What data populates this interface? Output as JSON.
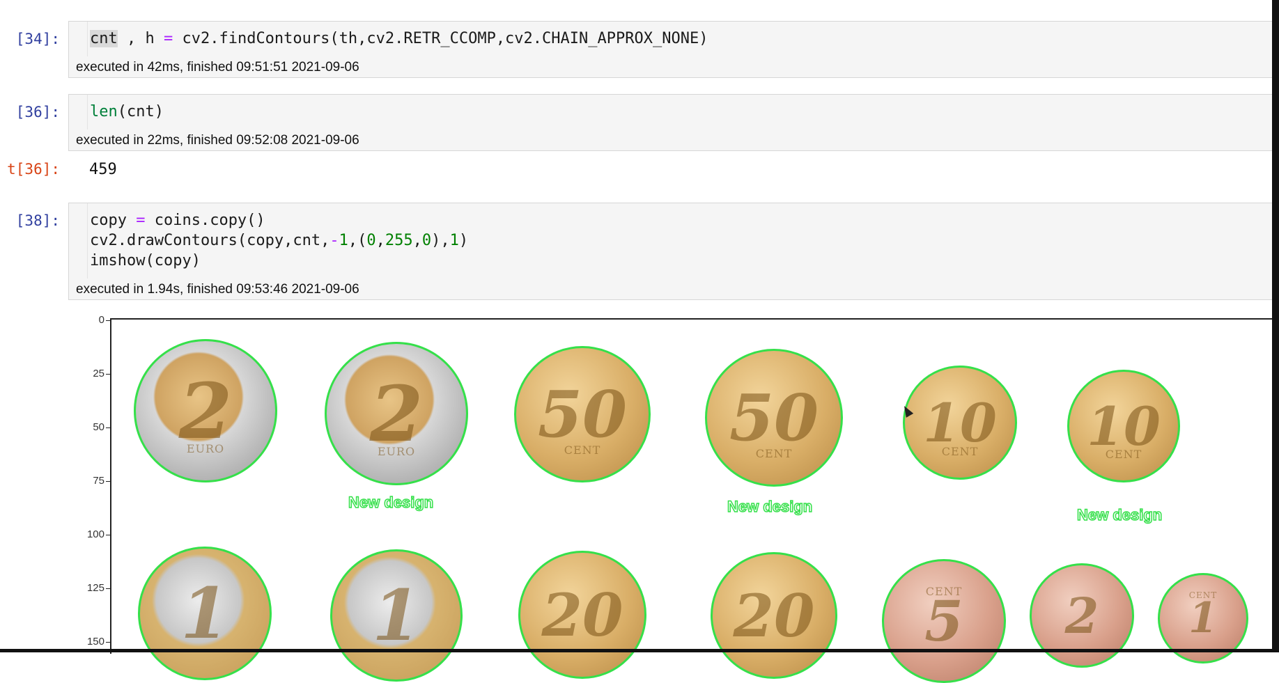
{
  "cells": [
    {
      "prompt": "[34]:",
      "code": [
        "cnt , h = cv2.findContours(th,cv2.RETR_CCOMP,cv2.CHAIN_APPROX_NONE)"
      ],
      "exec": "executed in 42ms, finished 09:51:51 2021-09-06"
    },
    {
      "prompt": "[36]:",
      "code": [
        "len(cnt)"
      ],
      "exec": "executed in 22ms, finished 09:52:08 2021-09-06",
      "out_prompt": "t[36]:",
      "output": "459"
    },
    {
      "prompt": "[38]:",
      "code": [
        "copy = coins.copy()",
        "cv2.drawContours(copy,cnt,-1,(0,255,0),1)",
        "imshow(copy)"
      ],
      "exec": "executed in 1.94s, finished 09:53:46 2021-09-06"
    }
  ],
  "plot": {
    "yticks": [
      "0",
      "25",
      "50",
      "75",
      "100",
      "125",
      "150"
    ],
    "top_row": [
      {
        "denom": "2",
        "sub": "EURO",
        "type": "bimetal"
      },
      {
        "denom": "2",
        "sub": "EURO",
        "type": "bimetal"
      },
      {
        "denom": "50",
        "sub": "CENT",
        "type": "gold"
      },
      {
        "denom": "50",
        "sub": "CENT",
        "type": "gold"
      },
      {
        "denom": "10",
        "sub": "CENT",
        "type": "gold"
      },
      {
        "denom": "10",
        "sub": "CENT",
        "type": "gold"
      }
    ],
    "labels": [
      "New design",
      "New design",
      "New design"
    ],
    "bottom_row": [
      {
        "denom": "1",
        "sub": "",
        "type": "silver"
      },
      {
        "denom": "1",
        "sub": "",
        "type": "silver"
      },
      {
        "denom": "20",
        "sub": "",
        "type": "gold"
      },
      {
        "denom": "20",
        "sub": "",
        "type": "gold"
      },
      {
        "denom": "5",
        "sub": "CENT",
        "type": "copper"
      },
      {
        "denom": "2",
        "sub": "",
        "type": "copper"
      },
      {
        "denom": "1",
        "sub": "CENT",
        "type": "copper"
      }
    ]
  }
}
